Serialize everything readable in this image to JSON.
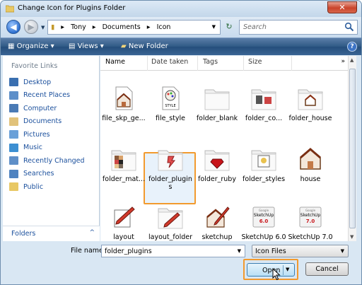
{
  "window": {
    "title": "Change Icon for Plugins Folder",
    "close_glyph": "✕"
  },
  "address": {
    "back_glyph": "◀",
    "forward_glyph": "▶",
    "crumbs": [
      "Tony",
      "Documents",
      "Icon"
    ],
    "separator": "▸",
    "search_placeholder": "Search",
    "refresh_glyph": "↻"
  },
  "toolbar": {
    "organize": "Organize ▾",
    "views": "Views ▾",
    "new_folder": "New Folder",
    "help": "?"
  },
  "sidebar": {
    "heading": "Favorite Links",
    "items": [
      {
        "label": "Desktop",
        "icon": "desktop-icon",
        "color": "#3a6fb0"
      },
      {
        "label": "Recent Places",
        "icon": "recent-places-icon",
        "color": "#5d8fc9"
      },
      {
        "label": "Computer",
        "icon": "computer-icon",
        "color": "#4a7ab5"
      },
      {
        "label": "Documents",
        "icon": "documents-icon",
        "color": "#e1c27a"
      },
      {
        "label": "Pictures",
        "icon": "pictures-icon",
        "color": "#6aa0d8"
      },
      {
        "label": "Music",
        "icon": "music-icon",
        "color": "#3c8fd2"
      },
      {
        "label": "Recently Changed",
        "icon": "recently-changed-icon",
        "color": "#5f8fc8"
      },
      {
        "label": "Searches",
        "icon": "searches-icon",
        "color": "#4f83c0"
      },
      {
        "label": "Public",
        "icon": "public-folder-icon",
        "color": "#e8c864"
      }
    ],
    "folders_label": "Folders",
    "folders_chevron": "^"
  },
  "columns": [
    "Name",
    "Date taken",
    "Tags",
    "Size"
  ],
  "columns_more": "»",
  "files": [
    {
      "label": "file_skp_ge...",
      "icon": "skp-file-icon"
    },
    {
      "label": "file_style",
      "icon": "style-file-icon"
    },
    {
      "label": "folder_blank",
      "icon": "blank-folder-icon"
    },
    {
      "label": "folder_co...",
      "icon": "component-folder-icon"
    },
    {
      "label": "folder_house",
      "icon": "house-folder-icon"
    },
    {
      "label": "folder_mat...",
      "icon": "materials-folder-icon"
    },
    {
      "label": "folder_plugins",
      "icon": "plugins-folder-icon",
      "selected": true
    },
    {
      "label": "folder_ruby",
      "icon": "ruby-folder-icon"
    },
    {
      "label": "folder_styles",
      "icon": "styles-folder-icon"
    },
    {
      "label": "house",
      "icon": "house-icon"
    },
    {
      "label": "layout",
      "icon": "layout-icon"
    },
    {
      "label": "layout_folder",
      "icon": "layout-folder-icon"
    },
    {
      "label": "sketchup",
      "icon": "sketchup-icon"
    },
    {
      "label": "SketchUp 6.0 ...",
      "icon": "sketchup-6-icon"
    },
    {
      "label": "SketchUp 7.0 ...",
      "icon": "sketchup-7-icon"
    }
  ],
  "footer": {
    "file_name_label": "File name:",
    "file_name_value": "folder_plugins",
    "file_type_value": "Icon Files",
    "open_label": "Open",
    "cancel_label": "Cancel"
  },
  "colors": {
    "selection_border": "#f29a2e",
    "toolbar": "#2f5985",
    "link": "#1a4f9c"
  }
}
